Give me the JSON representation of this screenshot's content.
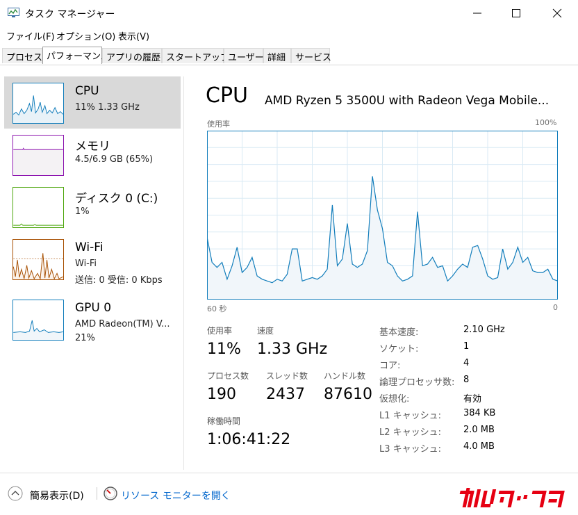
{
  "window": {
    "title": "タスク マネージャー"
  },
  "menu": [
    "ファイル(F)",
    "オプション(O)",
    "表示(V)"
  ],
  "tabs": [
    "プロセス",
    "パフォーマンス",
    "アプリの履歴",
    "スタートアップ",
    "ユーザー",
    "詳細",
    "サービス"
  ],
  "active_tab": "パフォーマンス",
  "sidebar": [
    {
      "name": "CPU",
      "line1": "11%  1.33 GHz",
      "line2": "",
      "color": "#117dbb",
      "fill": "#f1f6fa",
      "selected": true
    },
    {
      "name": "メモリ",
      "line1": "4.5/6.9 GB (65%)",
      "line2": "",
      "color": "#8b12ae",
      "fill": "#f4f2f4",
      "selected": false
    },
    {
      "name": "ディスク 0 (C:)",
      "line1": "1%",
      "line2": "",
      "color": "#4da60c",
      "fill": "#eff7ea",
      "selected": false
    },
    {
      "name": "Wi-Fi",
      "line1": "Wi-Fi",
      "line2": "送信: 0  受信: 0 Kbps",
      "color": "#a74f01",
      "fill": "#fcf3eb",
      "selected": false
    },
    {
      "name": "GPU 0",
      "line1": "AMD Radeon(TM) V...",
      "line2": "21%",
      "color": "#117dbb",
      "fill": "#f1f6fa",
      "selected": false
    }
  ],
  "main": {
    "title": "CPU",
    "model": "AMD Ryzen 5 3500U with Radeon Vega Mobile...",
    "chart_label": "使用率",
    "chart_max": "100%",
    "axis_left": "60 秒",
    "axis_right": "0"
  },
  "stats": {
    "usage_label": "使用率",
    "usage": "11%",
    "speed_label": "速度",
    "speed": "1.33 GHz",
    "processes_label": "プロセス数",
    "processes": "190",
    "threads_label": "スレッド数",
    "threads": "2437",
    "handles_label": "ハンドル数",
    "handles": "87610",
    "uptime_label": "稼働時間",
    "uptime": "1:06:41:22"
  },
  "specs": [
    {
      "label": "基本速度:",
      "value": "2.10 GHz"
    },
    {
      "label": "ソケット:",
      "value": "1"
    },
    {
      "label": "コア:",
      "value": "4"
    },
    {
      "label": "論理プロセッサ数:",
      "value": "8"
    },
    {
      "label": "仮想化:",
      "value": "有効"
    },
    {
      "label": "L1 キャッシュ:",
      "value": "384 KB"
    },
    {
      "label": "L2 キャッシュ:",
      "value": "2.0 MB"
    },
    {
      "label": "L3 キャッシュ:",
      "value": "4.0 MB"
    }
  ],
  "footer": {
    "fewer_details": "簡易表示(D)",
    "resource_monitor": "リソース モニターを開く"
  },
  "colors": {
    "accent": "#117dbb",
    "grid": "#d9eaf4",
    "link": "#0066cc"
  },
  "chart_data": {
    "type": "area",
    "ylim": [
      0,
      100
    ],
    "x_range_seconds": [
      60,
      0
    ],
    "values": [
      37,
      22,
      19,
      22,
      12,
      20,
      31,
      16,
      19,
      25,
      14,
      12,
      11,
      10,
      12,
      11,
      15,
      30,
      30,
      11,
      12,
      13,
      12,
      14,
      18,
      56,
      20,
      24,
      45,
      21,
      19,
      21,
      29,
      73,
      53,
      42,
      22,
      20,
      14,
      11,
      12,
      14,
      52,
      20,
      21,
      25,
      19,
      20,
      11,
      14,
      18,
      21,
      19,
      31,
      32,
      24,
      14,
      12,
      13,
      30,
      18,
      22,
      31,
      22,
      25,
      17,
      16,
      16,
      18,
      12,
      11
    ],
    "series": [
      {
        "values": [
          37,
          22,
          19,
          22,
          12,
          20,
          31,
          16,
          19,
          25,
          14,
          12,
          11,
          10,
          12,
          11,
          15,
          30,
          30,
          11,
          12,
          13,
          12,
          14,
          18,
          56,
          20,
          24,
          45,
          21,
          19,
          21,
          29,
          73,
          53,
          42,
          22,
          20,
          14,
          11,
          12,
          14,
          52,
          20,
          21,
          25,
          19,
          20,
          11,
          14,
          18,
          21,
          19,
          31,
          32,
          24,
          14,
          12,
          13,
          30,
          18,
          22,
          31,
          22,
          25,
          17,
          16,
          16,
          18,
          12,
          11
        ]
      }
    ]
  }
}
